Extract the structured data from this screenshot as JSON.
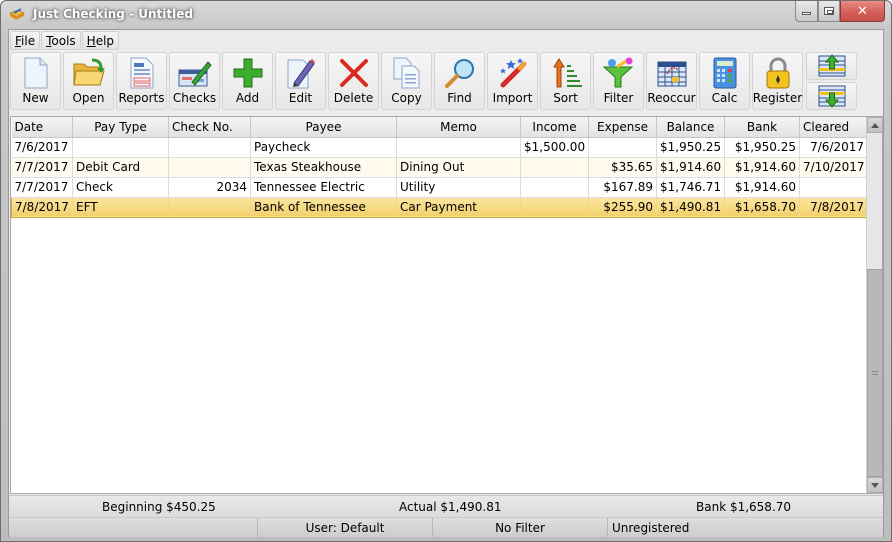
{
  "window": {
    "title": "Just Checking - Untitled",
    "close_glyph": "✕"
  },
  "menu": [
    {
      "label": "File",
      "accel": "F",
      "rest": "ile"
    },
    {
      "label": "Tools",
      "accel": "T",
      "rest": "ools"
    },
    {
      "label": "Help",
      "accel": "H",
      "rest": "elp"
    }
  ],
  "toolbar": [
    {
      "label": "New",
      "icon": "new-document-icon"
    },
    {
      "label": "Open",
      "icon": "open-folder-icon"
    },
    {
      "label": "Reports",
      "icon": "reports-icon"
    },
    {
      "label": "Checks",
      "icon": "checks-icon"
    },
    {
      "label": "Add",
      "icon": "add-plus-icon"
    },
    {
      "label": "Edit",
      "icon": "edit-pencil-icon"
    },
    {
      "label": "Delete",
      "icon": "delete-x-icon"
    },
    {
      "label": "Copy",
      "icon": "copy-documents-icon"
    },
    {
      "label": "Find",
      "icon": "magnifier-icon"
    },
    {
      "label": "Import",
      "icon": "magic-wand-icon"
    },
    {
      "label": "Sort",
      "icon": "sort-arrow-icon"
    },
    {
      "label": "Filter",
      "icon": "funnel-icon"
    },
    {
      "label": "Reoccur",
      "icon": "calendar-grid-icon"
    },
    {
      "label": "Calc",
      "icon": "calculator-icon"
    },
    {
      "label": "Register",
      "icon": "padlock-icon"
    }
  ],
  "move_buttons": {
    "up_icon": "move-row-up-icon",
    "down_icon": "move-row-down-icon"
  },
  "grid": {
    "columns": [
      "Date",
      "Pay Type",
      "Check No.",
      "Payee",
      "Memo",
      "Income",
      "Expense",
      "Balance",
      "Bank",
      "Cleared"
    ],
    "rows": [
      {
        "date": "7/6/2017",
        "pay_type": "",
        "check_no": "",
        "payee": "Paycheck",
        "memo": "",
        "income": "$1,500.00",
        "expense": "",
        "balance": "$1,950.25",
        "bank": "$1,950.25",
        "cleared": "7/6/2017",
        "selected": false
      },
      {
        "date": "7/7/2017",
        "pay_type": "Debit Card",
        "check_no": "",
        "payee": "Texas Steakhouse",
        "memo": "Dining Out",
        "income": "",
        "expense": "$35.65",
        "balance": "$1,914.60",
        "bank": "$1,914.60",
        "cleared": "7/10/2017",
        "selected": false
      },
      {
        "date": "7/7/2017",
        "pay_type": "Check",
        "check_no": "2034",
        "payee": "Tennessee Electric",
        "memo": "Utility",
        "income": "",
        "expense": "$167.89",
        "balance": "$1,746.71",
        "bank": "$1,914.60",
        "cleared": "",
        "selected": false
      },
      {
        "date": "7/8/2017",
        "pay_type": "EFT",
        "check_no": "",
        "payee": "Bank of Tennessee",
        "memo": "Car Payment",
        "income": "",
        "expense": "$255.90",
        "balance": "$1,490.81",
        "bank": "$1,658.70",
        "cleared": "7/8/2017",
        "selected": true
      }
    ]
  },
  "summary": {
    "beginning": "Beginning $450.25",
    "actual": "Actual $1,490.81",
    "bank": "Bank $1,658.70"
  },
  "status": {
    "pane1": "",
    "user": "User: Default",
    "filter": "No Filter",
    "registration": "Unregistered"
  },
  "colors": {
    "selected_row": "#f2cf6a",
    "alt_row": "#fff9ee",
    "close_button": "#d35c57"
  }
}
